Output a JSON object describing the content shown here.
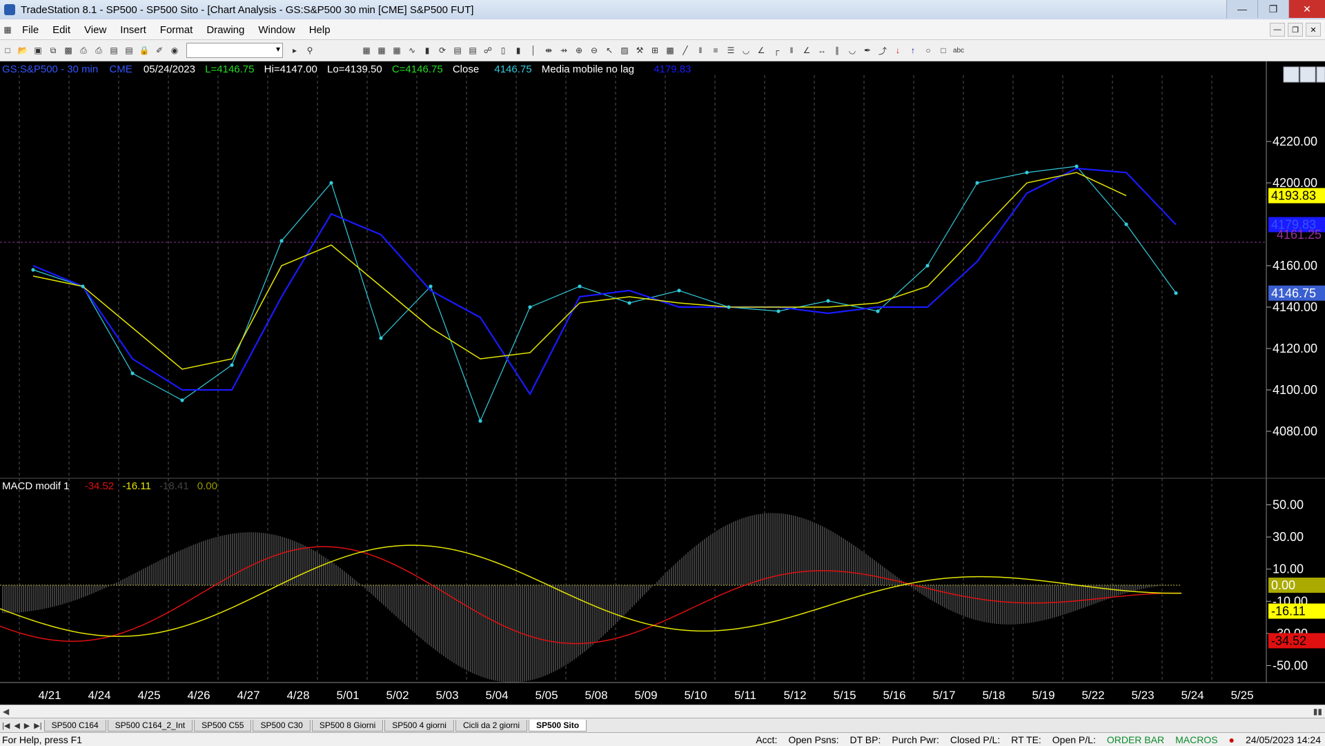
{
  "window": {
    "title": "TradeStation 8.1 - SP500 - SP500 Sito - [Chart Analysis - GS:S&P500  30 min  [CME] S&P500 FUT]"
  },
  "menu": [
    "File",
    "Edit",
    "View",
    "Insert",
    "Format",
    "Drawing",
    "Window",
    "Help"
  ],
  "header": {
    "symbol": "GS:S&P500 - 30 min",
    "exchange": "CME",
    "date": "05/24/2023",
    "last": "L=4146.75",
    "high": "Hi=4147.00",
    "low": "Lo=4139.50",
    "close_eq": "C=4146.75",
    "close_label": "Close",
    "close_value": "4146.75",
    "indicator_name": "Media mobile no lag",
    "indicator_value": "4179.83"
  },
  "price_axis": {
    "ticks": [
      "4220.00",
      "4200.00",
      "4160.00",
      "4140.00",
      "4120.00",
      "4100.00",
      "4080.00"
    ]
  },
  "price_markers": {
    "yellow": "4193.83",
    "blue": "4179.83",
    "cyan": "4146.75",
    "purple_line": "4161.25"
  },
  "macd": {
    "label": "MACD modif 1",
    "v1": "-34.52",
    "v2": "-16.11",
    "v3": "-18.41",
    "v4": "0.00",
    "axis_ticks": [
      "50.00",
      "30.00",
      "10.00",
      "-10.00",
      "-30.00",
      "-50.00"
    ],
    "markers": {
      "zero": "0.00",
      "yellow": "-16.11",
      "red": "-34.52"
    }
  },
  "date_axis": [
    "4/21",
    "4/24",
    "4/25",
    "4/26",
    "4/27",
    "4/28",
    "5/01",
    "5/02",
    "5/03",
    "5/04",
    "5/05",
    "5/08",
    "5/09",
    "5/10",
    "5/11",
    "5/12",
    "5/15",
    "5/16",
    "5/17",
    "5/18",
    "5/19",
    "5/22",
    "5/23",
    "5/24",
    "5/25"
  ],
  "tabs": [
    "SP500 C164",
    "SP500 C164_2_Int",
    "SP500 C55",
    "SP500 C30",
    "SP500 8 Giorni",
    "SP500 4 giorni",
    "Cicli da 2 giorni",
    "SP500 Sito"
  ],
  "active_tab": "SP500 Sito",
  "status": {
    "help": "For Help, press F1",
    "acct": "Acct:",
    "open_psns": "Open Psns:",
    "dt_bp": "DT BP:",
    "purch_pwr": "Purch Pwr:",
    "closed_pl": "Closed P/L:",
    "rt_te": "RT TE:",
    "open_pl": "Open P/L:",
    "order_bar": "ORDER BAR",
    "macros": "MACROS",
    "datetime": "24/05/2023 14:24"
  },
  "colors": {
    "price": "#33ccdd",
    "ma_blue": "#1a1aff",
    "ma_yellow": "#e6e600",
    "macd_red": "#e01010",
    "macd_yellow": "#e6e600",
    "hist": "#777777",
    "purple": "#993399"
  },
  "chart_data": {
    "type": "line",
    "x": [
      "4/21",
      "4/24",
      "4/25",
      "4/26",
      "4/27",
      "4/28",
      "5/01",
      "5/02",
      "5/03",
      "5/04",
      "5/05",
      "5/08",
      "5/09",
      "5/10",
      "5/11",
      "5/12",
      "5/15",
      "5/16",
      "5/17",
      "5/18",
      "5/19",
      "5/22",
      "5/23",
      "5/24"
    ],
    "ylim": [
      4065,
      4232
    ],
    "series": [
      {
        "values": [
          4158,
          4150,
          4108,
          4095,
          4112,
          4172,
          4200,
          4125,
          4150,
          4085,
          4140,
          4150,
          4142,
          4148,
          4140,
          4138,
          4143,
          4138,
          4160,
          4200,
          4205,
          4208,
          4180,
          4146.75
        ]
      },
      {
        "values": [
          4160,
          4150,
          4115,
          4100,
          4100,
          4145,
          4185,
          4175,
          4148,
          4135,
          4098,
          4145,
          4148,
          4140,
          4140,
          4140,
          4137,
          4140,
          4140,
          4162,
          4195,
          4207,
          4205,
          4179.83
        ]
      },
      {
        "values": [
          4155,
          4150,
          4130,
          4110,
          4115,
          4160,
          4170,
          4150,
          4130,
          4115,
          4118,
          4142,
          4145,
          4142,
          4140,
          4140,
          4140,
          4142,
          4150,
          4175,
          4200,
          4205,
          4193.83
        ]
      }
    ]
  }
}
